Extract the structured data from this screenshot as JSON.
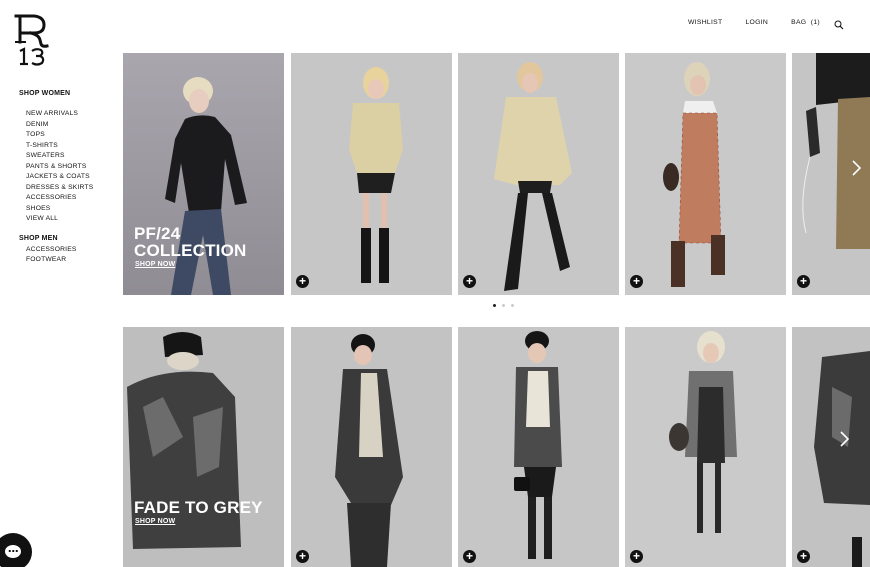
{
  "brand": {
    "logo_text": "R13",
    "logo_icon": "r13-logo"
  },
  "header": {
    "wishlist": "WISHLIST",
    "login": "LOGIN",
    "bag": "BAG",
    "bag_count": "(1)",
    "search_icon": "search-icon"
  },
  "nav": {
    "women": {
      "heading": "SHOP WOMEN",
      "items": [
        "NEW ARRIVALS",
        "DENIM",
        "TOPS",
        "T-SHIRTS",
        "SWEATERS",
        "PANTS & SHORTS",
        "JACKETS & COATS",
        "DRESSES & SKIRTS",
        "ACCESSORIES",
        "SHOES",
        "VIEW ALL"
      ]
    },
    "men": {
      "heading": "SHOP MEN",
      "items": [
        "ACCESSORIES",
        "FOOTWEAR"
      ]
    }
  },
  "collections": [
    {
      "title_line1": "PF/24",
      "title_line2": "COLLECTION",
      "cta": "SHOP NOW",
      "carousel_page": 1,
      "carousel_pages": 3
    },
    {
      "title_line1": "FADE TO GREY",
      "cta": "SHOP NOW"
    }
  ],
  "icons": {
    "quick_add": "plus-icon",
    "next": "chevron-right-icon",
    "chat": "chat-icon"
  },
  "colors": {
    "text": "#111111",
    "background": "#ffffff",
    "photo_backdrop": "#c9c9c9"
  }
}
